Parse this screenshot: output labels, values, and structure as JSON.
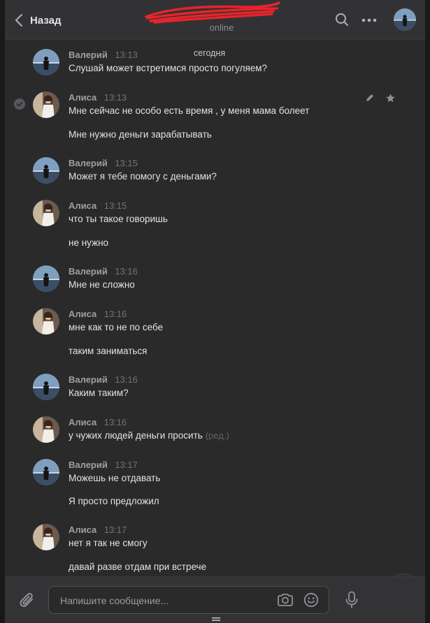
{
  "header": {
    "back_label": "Назад",
    "peer_status": "online",
    "icons": {
      "back": "chevron-left-icon",
      "search": "search-icon",
      "more": "more-dots-icon"
    }
  },
  "date_separator": "сегодня",
  "messages": [
    {
      "author": "Валерий",
      "time": "13:13",
      "lines": [
        "Слушай может встретимся просто погуляем?"
      ]
    },
    {
      "author": "Алиса",
      "time": "13:13",
      "lines": [
        "Мне сейчас не особо есть время , у меня мама болеет",
        "Мне нужно деньги зарабатывать"
      ]
    },
    {
      "author": "Валерий",
      "time": "13:15",
      "lines": [
        "Может я тебе помогу с деньгами?"
      ]
    },
    {
      "author": "Алиса",
      "time": "13:15",
      "lines": [
        "что ты такое говоришь",
        "не нужно"
      ]
    },
    {
      "author": "Валерий",
      "time": "13:16",
      "lines": [
        "Мне не сложно"
      ]
    },
    {
      "author": "Алиса",
      "time": "13:16",
      "lines": [
        "мне как то не по себе",
        "таким заниматься"
      ]
    },
    {
      "author": "Валерий",
      "time": "13:16",
      "lines": [
        "Каким таким?"
      ]
    },
    {
      "author": "Алиса",
      "time": "13:16",
      "lines": [
        "у чужих людей деньги просить"
      ],
      "edited": "(ред.)"
    },
    {
      "author": "Валерий",
      "time": "13:17",
      "lines": [
        "Можешь не отдавать",
        "Я просто предложил"
      ]
    },
    {
      "author": "Алиса",
      "time": "13:17",
      "lines": [
        "нет я так не смогу",
        "давай разве отдам при встрече"
      ]
    }
  ],
  "composer": {
    "placeholder": "Напишите сообщение..."
  },
  "colors": {
    "background": "#2a2a2b",
    "header": "#323234",
    "text": "#e1e3e6",
    "muted": "#9ba0a6",
    "redaction": "#e8242a"
  }
}
